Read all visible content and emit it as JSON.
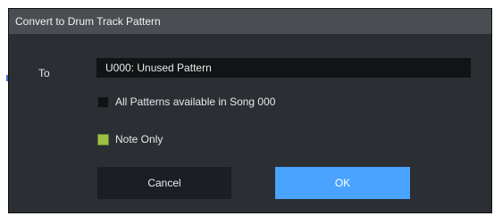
{
  "dialog": {
    "title": "Convert to Drum Track Pattern",
    "to_label": "To",
    "pattern_value": "U000: Unused Pattern",
    "option_all_patterns": {
      "label": "All Patterns available in Song 000",
      "checked": false
    },
    "option_note_only": {
      "label": "Note Only",
      "checked": true
    },
    "cancel_label": "Cancel",
    "ok_label": "OK"
  },
  "colors": {
    "dialog_bg": "#2b2e33",
    "titlebar_bg": "#4a4d52",
    "field_bg": "#121314",
    "cancel_bg": "#1b1e24",
    "ok_bg": "#4aa3ff",
    "checkbox_on": "#9cc043",
    "checkbox_off": "#101112"
  }
}
